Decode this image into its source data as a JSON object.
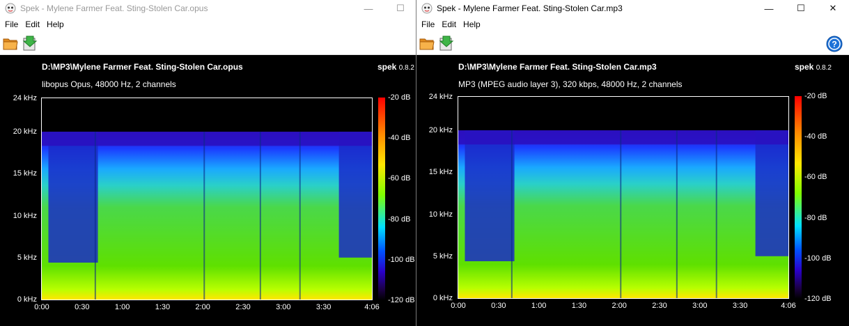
{
  "left_window": {
    "title": "Spek - Mylene Farmer Feat. Sting-Stolen Car.opus",
    "caption": [
      "—",
      "☐"
    ],
    "menu": [
      "File",
      "Edit",
      "Help"
    ],
    "file_title": "D:\\MP3\\Mylene Farmer Feat. Sting-Stolen Car.opus",
    "file_info": "libopus Opus, 48000 Hz, 2 channels",
    "brand_name": "spek",
    "brand_version": "0.8.2",
    "freq_ticks": [
      "24 kHz",
      "20 kHz",
      "15 kHz",
      "10 kHz",
      "5 kHz",
      "0 kHz"
    ],
    "time_ticks": [
      "0:00",
      "0:30",
      "1:00",
      "1:30",
      "2:00",
      "2:30",
      "3:00",
      "3:30",
      "4:06"
    ],
    "db_ticks": [
      "-20 dB",
      "-40 dB",
      "-60 dB",
      "-80 dB",
      "-100 dB",
      "-120 dB"
    ],
    "cutoff_khz": 20
  },
  "right_window": {
    "title": "Spek - Mylene Farmer Feat. Sting-Stolen Car.mp3",
    "caption": [
      "—",
      "☐",
      "✕"
    ],
    "menu": [
      "File",
      "Edit",
      "Help"
    ],
    "file_title": "D:\\MP3\\Mylene Farmer Feat. Sting-Stolen Car.mp3",
    "file_info": "MP3 (MPEG audio layer 3), 320 kbps, 48000 Hz, 2 channels",
    "brand_name": "spek",
    "brand_version": "0.8.2",
    "freq_ticks": [
      "24 kHz",
      "20 kHz",
      "15 kHz",
      "10 kHz",
      "5 kHz",
      "0 kHz"
    ],
    "time_ticks": [
      "0:00",
      "0:30",
      "1:00",
      "1:30",
      "2:00",
      "2:30",
      "3:00",
      "3:30",
      "4:06"
    ],
    "db_ticks": [
      "-20 dB",
      "-40 dB",
      "-60 dB",
      "-80 dB",
      "-100 dB",
      "-120 dB"
    ],
    "cutoff_khz": 20
  },
  "icons": {
    "app": "spek-app-icon",
    "open": "open-folder-icon",
    "save": "save-arrow-icon",
    "help": "help-circle-icon"
  },
  "colors": {
    "background": "#000000",
    "spectrum_high": "#ff0000",
    "spectrum_mid": "#7fff00",
    "spectrum_low": "#2a00c8"
  }
}
